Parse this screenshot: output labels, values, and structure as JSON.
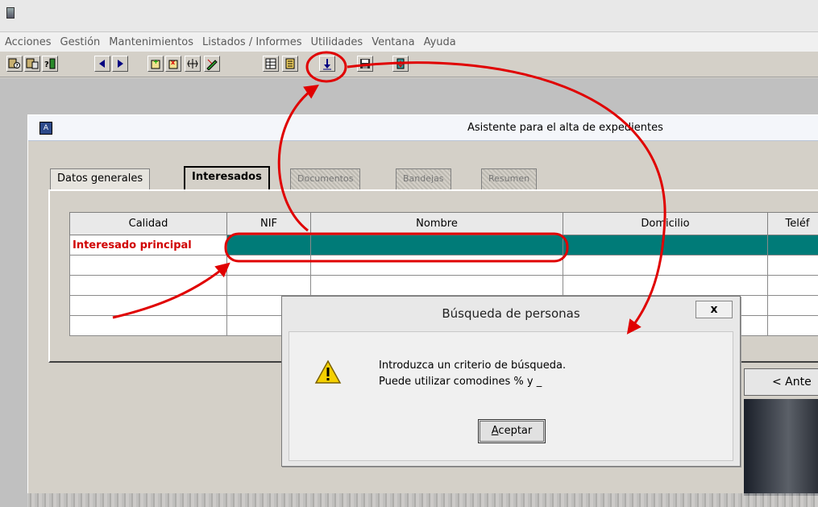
{
  "menu": {
    "items": [
      "Acciones",
      "Gestión",
      "Mantenimientos",
      "Listados / Informes",
      "Utilidades",
      "Ventana",
      "Ayuda"
    ]
  },
  "toolbar": {
    "buttons": [
      {
        "icon": "users-query-icon"
      },
      {
        "icon": "users-new-icon"
      },
      {
        "icon": "users-help-icon"
      },
      {
        "icon": "prev-arrow-icon"
      },
      {
        "icon": "next-arrow-icon"
      },
      {
        "icon": "insert-record-icon"
      },
      {
        "icon": "delete-record-icon"
      },
      {
        "icon": "grid-icon"
      },
      {
        "icon": "edit-icon"
      },
      {
        "icon": "list-icon"
      },
      {
        "icon": "document-icon"
      },
      {
        "icon": "download-arrow-icon"
      },
      {
        "icon": "save-icon"
      },
      {
        "icon": "exit-icon"
      }
    ]
  },
  "wizard": {
    "title": "Asistente para el alta de expedientes",
    "tabs": [
      {
        "label": "Datos generales",
        "state": "normal"
      },
      {
        "label": "Interesados",
        "state": "active"
      },
      {
        "label": "Documentos",
        "state": "disabled"
      },
      {
        "label": "Bandejas",
        "state": "disabled"
      },
      {
        "label": "Resumen",
        "state": "disabled"
      }
    ],
    "table": {
      "columns": [
        "Calidad",
        "NIF",
        "Nombre",
        "Domicilio",
        "Teléf"
      ],
      "rows": [
        [
          "Interesado principal",
          "",
          "",
          "",
          ""
        ],
        [
          "",
          "",
          "",
          "",
          ""
        ],
        [
          "",
          "",
          "",
          "",
          ""
        ],
        [
          "",
          "",
          "",
          "",
          ""
        ],
        [
          "",
          "",
          "",
          "",
          ""
        ]
      ]
    },
    "prev_button": "< Ante"
  },
  "dialog": {
    "title": "Búsqueda de personas",
    "close": "x",
    "line1": "Introduzca un criterio de búsqueda.",
    "line2": "Puede utilizar comodines % y _",
    "ok_accel": "A",
    "ok_rest": "ceptar",
    "icon": "warning-icon"
  },
  "colors": {
    "selected_row": "#007b78",
    "annotation": "#e00000",
    "calidad_text": "#d00000"
  }
}
